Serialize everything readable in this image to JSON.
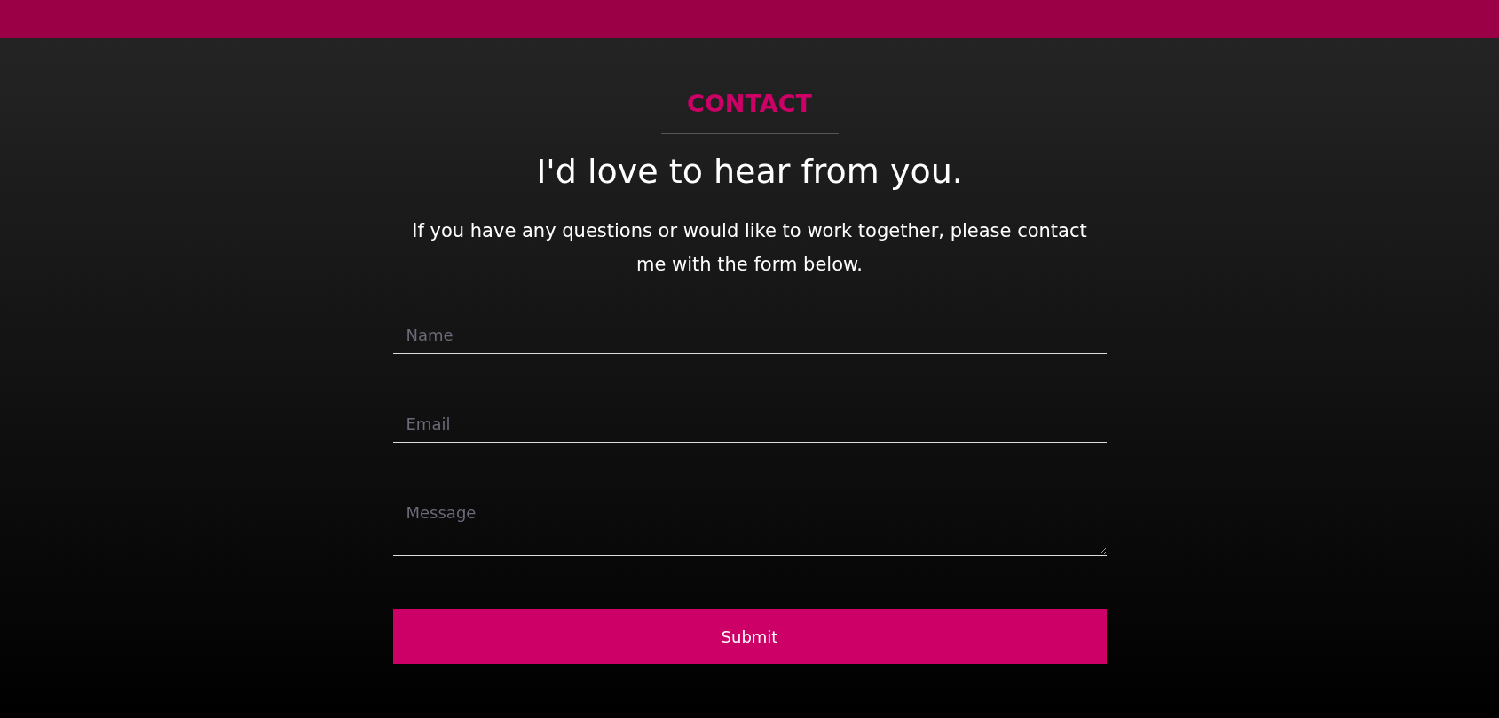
{
  "section_label": "CONTACT",
  "heading": "I'd love to hear from you.",
  "intro": "If you have any questions or would like to work together, please contact me with the form below.",
  "fields": [
    {
      "kind": "input",
      "placeholder": "Name"
    },
    {
      "kind": "input",
      "placeholder": "Email"
    },
    {
      "kind": "textarea",
      "placeholder": "Message"
    }
  ],
  "submit": "Submit"
}
